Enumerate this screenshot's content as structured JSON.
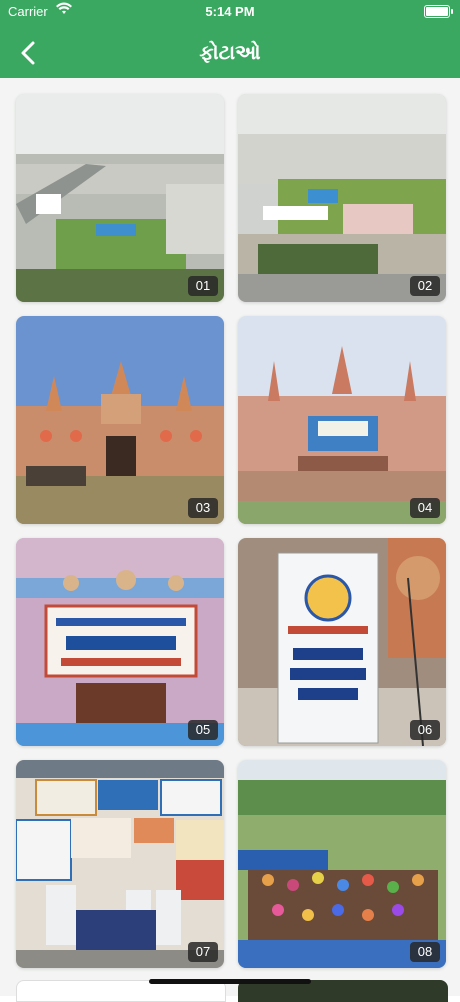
{
  "status": {
    "carrier": "Carrier",
    "time": "5:14 PM"
  },
  "nav": {
    "title": "ફોટાઓ"
  },
  "colors": {
    "header": "#3aa860"
  },
  "photos": [
    {
      "label": "01"
    },
    {
      "label": "02"
    },
    {
      "label": "03"
    },
    {
      "label": "04"
    },
    {
      "label": "05"
    },
    {
      "label": "06"
    },
    {
      "label": "07"
    },
    {
      "label": "08"
    }
  ]
}
